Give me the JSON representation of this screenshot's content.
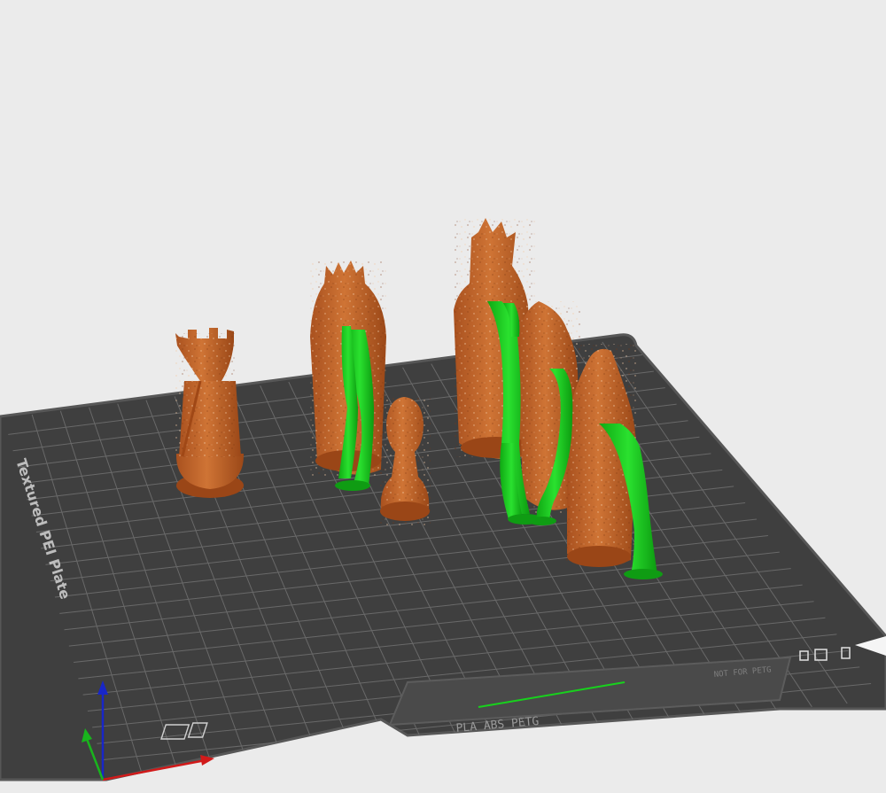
{
  "plate": {
    "side_label": "Textured PEI Plate",
    "bottom_label": "PLA ABS PETG",
    "right_label": "NOT FOR PETG"
  },
  "colors": {
    "background": "#ebebeb",
    "plate": "#3f3f3f",
    "plate_border": "#575757",
    "grid": "#6e6e6e",
    "model": "#c0622a",
    "model_dark": "#8f4214",
    "support": "#18d11d",
    "axis_x": "#d11a1a",
    "axis_y": "#19b41d",
    "axis_z": "#1826c8"
  },
  "models": [
    "rook",
    "queen",
    "pawn",
    "king",
    "bishop",
    "knight"
  ]
}
